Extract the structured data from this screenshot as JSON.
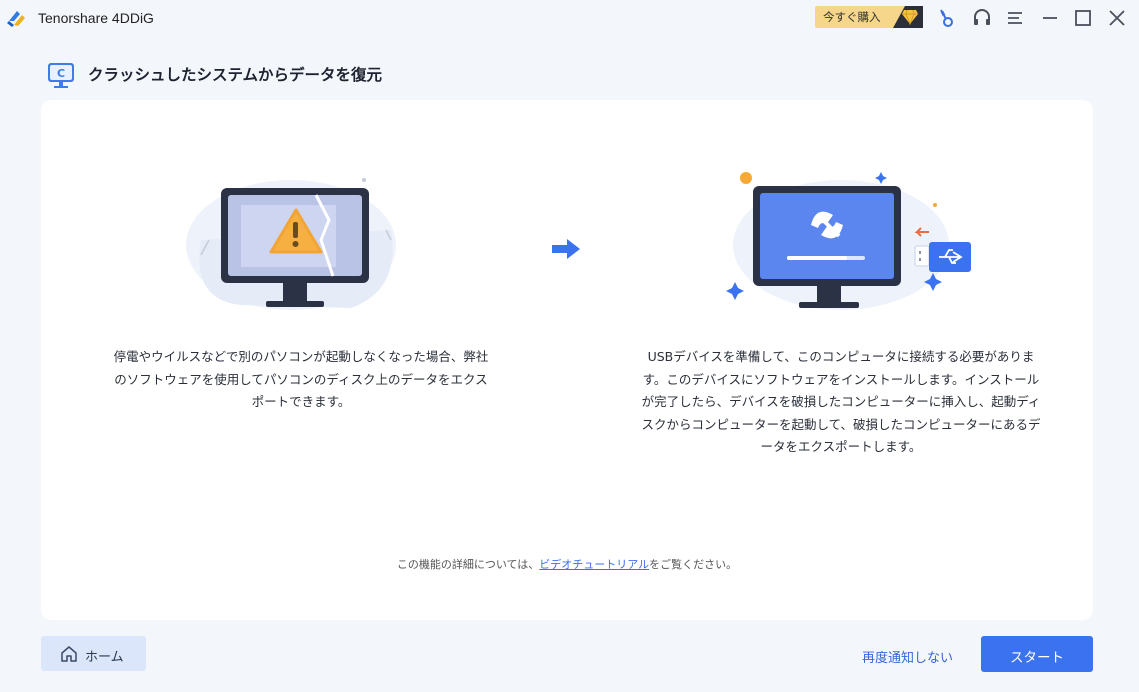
{
  "titlebar": {
    "app_title": "Tenorshare 4DDiG",
    "buy_label": "今すぐ購入"
  },
  "header": {
    "title": "クラッシュしたシステムからデータを復元"
  },
  "main": {
    "left_description": "停電やウイルスなどで別のパソコンが起動しなくなった場合、弊社のソフトウェアを使用してパソコンのディスク上のデータをエクスポートできます。",
    "right_description": "USBデバイスを準備して、このコンピュータに接続する必要があります。このデバイスにソフトウェアをインストールします。インストールが完了したら、デバイスを破損したコンピューターに挿入し、起動ディスクからコンピューターを起動して、破損したコンピューターにあるデータをエクスポートします。",
    "footer_prefix": "この機能の詳細については、",
    "footer_link": "ビデオチュートリアル",
    "footer_suffix": "をご覧ください。"
  },
  "bottom": {
    "home_label": "ホーム",
    "dismiss_label": "再度通知しない",
    "start_label": "スタート"
  },
  "icons": {
    "buy": "diamond-icon",
    "titlebar": [
      "key-icon",
      "headset-icon",
      "menu-icon",
      "minimize-icon",
      "maximize-icon",
      "close-icon"
    ],
    "home": "home-icon"
  },
  "colors": {
    "accent": "#3a72f0",
    "buy_bg": "#f5d68a",
    "home_bg": "#dbe6fb",
    "link": "#3667d6"
  }
}
